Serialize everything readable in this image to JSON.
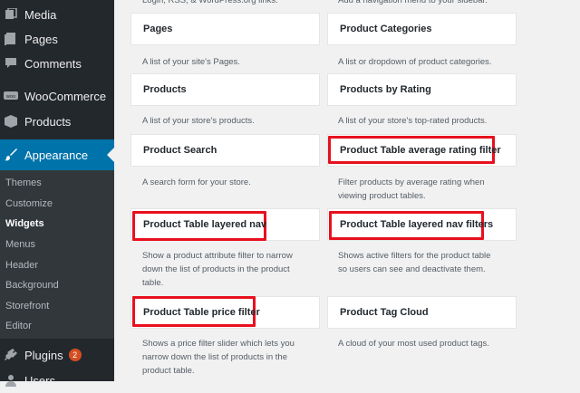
{
  "sidebar": {
    "menu": [
      {
        "label": "Media",
        "icon": "media-icon"
      },
      {
        "label": "Pages",
        "icon": "pages-icon"
      },
      {
        "label": "Comments",
        "icon": "comments-icon"
      },
      {
        "label": "WooCommerce",
        "icon": "woocommerce-icon"
      },
      {
        "label": "Products",
        "icon": "products-icon"
      },
      {
        "label": "Appearance",
        "icon": "appearance-icon"
      },
      {
        "label": "Plugins",
        "icon": "plugins-icon",
        "badge": "2"
      },
      {
        "label": "Users",
        "icon": "users-icon"
      }
    ],
    "submenu": [
      "Themes",
      "Customize",
      "Widgets",
      "Menus",
      "Header",
      "Background",
      "Storefront",
      "Editor"
    ],
    "current_submenu": "Widgets"
  },
  "top_clipped": {
    "left": "Login, RSS, & WordPress.org links.",
    "right": "Add a navigation menu to your sidebar."
  },
  "widgets": [
    {
      "title": "Pages",
      "description": "A list of your site's Pages.",
      "highlighted": false
    },
    {
      "title": "Product Categories",
      "description": "A list or dropdown of product categories.",
      "highlighted": false
    },
    {
      "title": "Products",
      "description": "A list of your store's products.",
      "highlighted": false
    },
    {
      "title": "Products by Rating",
      "description": "A list of your store's top-rated products.",
      "highlighted": false
    },
    {
      "title": "Product Search",
      "description": "A search form for your store.",
      "highlighted": false
    },
    {
      "title": "Product Table average rating filter",
      "description": [
        "Filter products by average rating when",
        "viewing product tables."
      ],
      "highlighted": true
    },
    {
      "title": "Product Table layered nav",
      "description": [
        "Show a product attribute filter to narrow",
        "down the list of products in the product",
        "table."
      ],
      "highlighted": true
    },
    {
      "title": "Product Table layered nav filters",
      "description": [
        "Shows active filters for the product table",
        "so users can see and deactivate them."
      ],
      "highlighted": true
    },
    {
      "title": "Product Table price filter",
      "description": [
        "Shows a price filter slider which lets you",
        "narrow down the list of products in the",
        "product table."
      ],
      "highlighted": true
    },
    {
      "title": "Product Tag Cloud",
      "description": "A cloud of your most used product tags.",
      "highlighted": false
    }
  ],
  "colors": {
    "sidebar_bg": "#23282d",
    "submenu_bg": "#32373c",
    "active_bg": "#0073aa",
    "highlight_border": "#e8101e",
    "badge_bg": "#d54e21"
  }
}
